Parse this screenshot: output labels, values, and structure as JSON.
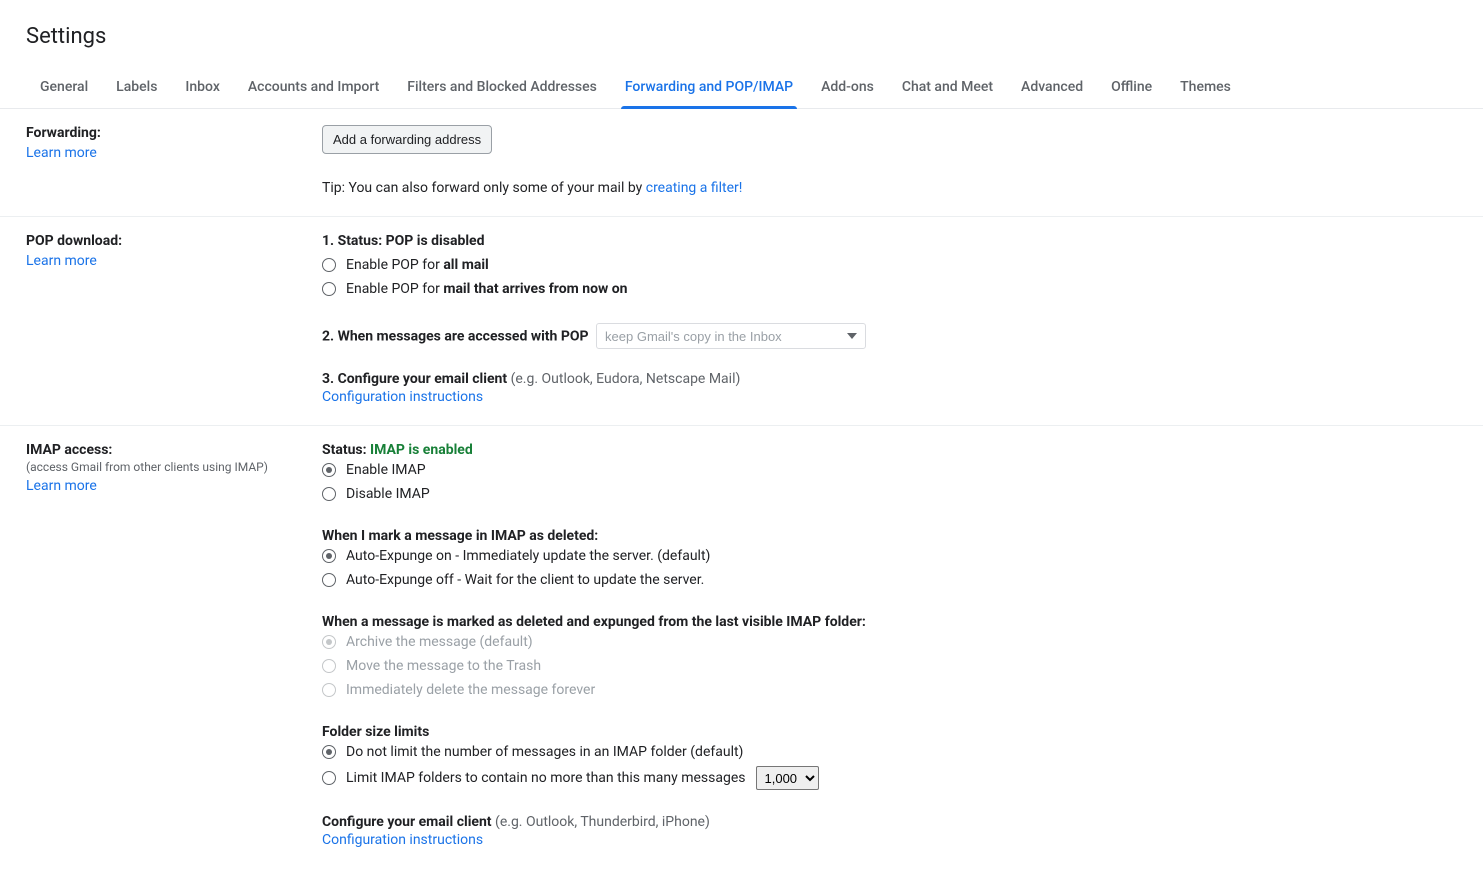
{
  "header": {
    "title": "Settings"
  },
  "tabs": [
    {
      "label": "General",
      "active": false
    },
    {
      "label": "Labels",
      "active": false
    },
    {
      "label": "Inbox",
      "active": false
    },
    {
      "label": "Accounts and Import",
      "active": false
    },
    {
      "label": "Filters and Blocked Addresses",
      "active": false
    },
    {
      "label": "Forwarding and POP/IMAP",
      "active": true
    },
    {
      "label": "Add-ons",
      "active": false
    },
    {
      "label": "Chat and Meet",
      "active": false
    },
    {
      "label": "Advanced",
      "active": false
    },
    {
      "label": "Offline",
      "active": false
    },
    {
      "label": "Themes",
      "active": false
    }
  ],
  "forwarding": {
    "label": "Forwarding:",
    "learn_more": "Learn more",
    "add_button": "Add a forwarding address",
    "tip_prefix": "Tip: You can also forward only some of your mail by ",
    "tip_link": "creating a filter!"
  },
  "pop": {
    "label": "POP download:",
    "learn_more": "Learn more",
    "status_heading_prefix": "1. Status: ",
    "status_value": "POP is disabled",
    "option_all_prefix": "Enable POP for ",
    "option_all_bold": "all mail",
    "option_new_prefix": "Enable POP for ",
    "option_new_bold": "mail that arrives from now on",
    "accessed_heading": "2. When messages are accessed with POP",
    "accessed_select": "keep Gmail's copy in the Inbox",
    "configure_heading": "3. Configure your email client ",
    "configure_note": "(e.g. Outlook, Eudora, Netscape Mail)",
    "configure_link": "Configuration instructions"
  },
  "imap": {
    "label": "IMAP access:",
    "desc": "(access Gmail from other clients using IMAP)",
    "learn_more": "Learn more",
    "status_label": "Status: ",
    "status_value": "IMAP is enabled",
    "option_enable": "Enable IMAP",
    "option_disable": "Disable IMAP",
    "deleted_heading": "When I mark a message in IMAP as deleted:",
    "deleted_on": "Auto-Expunge on - Immediately update the server. (default)",
    "deleted_off": "Auto-Expunge off - Wait for the client to update the server.",
    "expunged_heading": "When a message is marked as deleted and expunged from the last visible IMAP folder:",
    "expunged_archive": "Archive the message (default)",
    "expunged_trash": "Move the message to the Trash",
    "expunged_delete": "Immediately delete the message forever",
    "folder_heading": "Folder size limits",
    "folder_nolimit": "Do not limit the number of messages in an IMAP folder (default)",
    "folder_limit": "Limit IMAP folders to contain no more than this many messages",
    "folder_limit_count": "1,000",
    "configure_heading": "Configure your email client ",
    "configure_note": "(e.g. Outlook, Thunderbird, iPhone)",
    "configure_link": "Configuration instructions"
  }
}
